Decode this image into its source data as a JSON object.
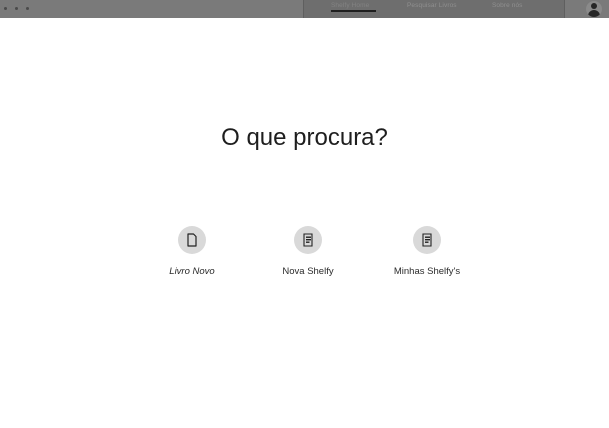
{
  "topbar": {
    "nav": [
      {
        "label": "Shelfy Home",
        "active": true
      },
      {
        "label": "Pesquisar Livros",
        "active": false
      },
      {
        "label": "Sobre nós",
        "active": false
      }
    ]
  },
  "main": {
    "heading": "O que procura?",
    "options": [
      {
        "label": "Livro Novo",
        "icon": "document-icon"
      },
      {
        "label": "Nova Shelfy",
        "icon": "list-document-icon"
      },
      {
        "label": "Minhas Shelfy's",
        "icon": "list-document-icon"
      }
    ]
  },
  "colors": {
    "topbar_bg": "#7a7a7a",
    "nav_bg": "#6e6e6e",
    "icon_circle": "#d9d9d9",
    "text": "#1e1e1e"
  }
}
